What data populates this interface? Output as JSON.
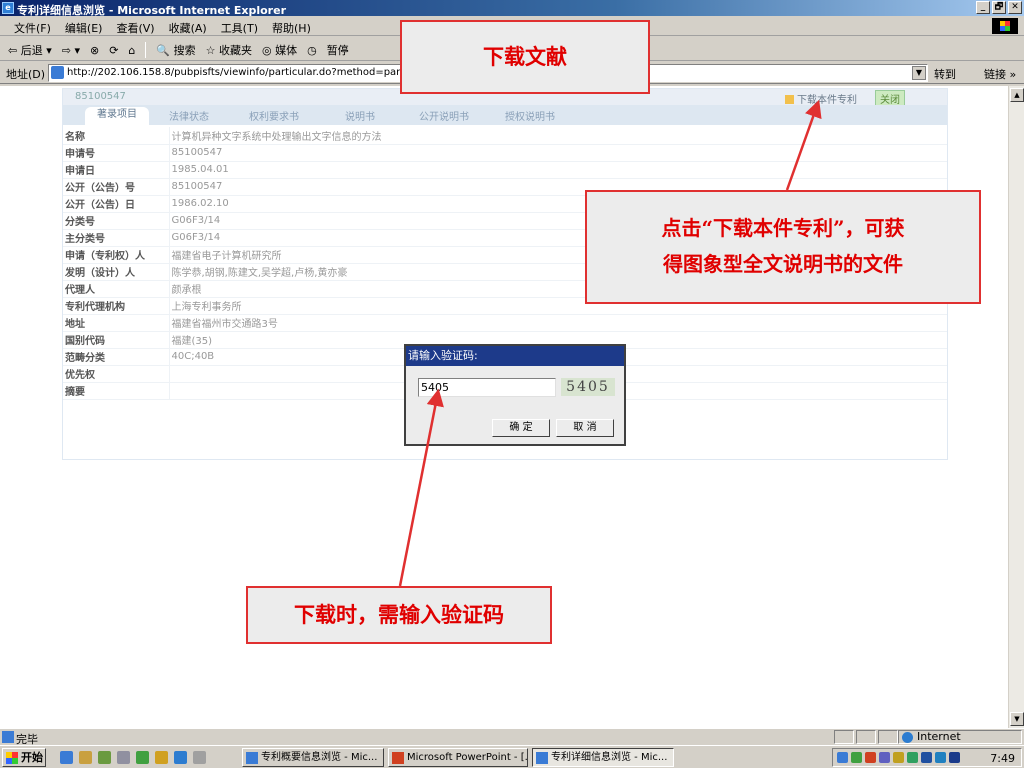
{
  "window": {
    "title": "专利详细信息浏览 - Microsoft Internet Explorer",
    "controls": [
      "_",
      "🗗",
      "✕"
    ]
  },
  "menu": [
    "文件(F)",
    "编辑(E)",
    "查看(V)",
    "收藏(A)",
    "工具(T)",
    "帮助(H)"
  ],
  "toolbar": [
    "⇦ 后退 ▾",
    "⇨ ▾",
    "⊗",
    "⟳",
    "⌂",
    "🔍 搜索",
    "☆ 收藏夹",
    "◎ 媒体",
    "◷",
    "暂停"
  ],
  "address": {
    "label": "地址(D)",
    "url": "http://202.106.158.8/pubpisfts/viewinfo/particular.do?method=partizlxm&ind",
    "go": "转到",
    "links": "链接 »"
  },
  "patent": {
    "number": "85100547",
    "download_link": "下载本件专利",
    "close": "关闭",
    "tabs": [
      "著录项目",
      "法律状态",
      "权利要求书",
      "说明书",
      "公开说明书",
      "授权说明书"
    ],
    "fields": [
      {
        "k": "名称",
        "v": "计算机异种文字系统中处理输出文字信息的方法"
      },
      {
        "k": "申请号",
        "v": "85100547"
      },
      {
        "k": "申请日",
        "v": "1985.04.01"
      },
      {
        "k": "公开（公告）号",
        "v": "85100547"
      },
      {
        "k": "公开（公告）日",
        "v": "1986.02.10"
      },
      {
        "k": "分类号",
        "v": "G06F3/14"
      },
      {
        "k": "主分类号",
        "v": "G06F3/14"
      },
      {
        "k": "申请（专利权）人",
        "v": "福建省电子计算机研究所"
      },
      {
        "k": "发明（设计）人",
        "v": "陈学恭,胡钢,陈建文,吴学超,卢杨,黄亦豪"
      },
      {
        "k": "代理人",
        "v": "颜承根"
      },
      {
        "k": "专利代理机构",
        "v": "上海专利事务所"
      },
      {
        "k": "地址",
        "v": "福建省福州市交通路3号"
      },
      {
        "k": "国别代码",
        "v": "福建(35)"
      },
      {
        "k": "范畴分类",
        "v": "40C;40B"
      },
      {
        "k": "优先权",
        "v": ""
      },
      {
        "k": "摘要",
        "v": ""
      }
    ]
  },
  "dialog": {
    "title": "请输入验证码:",
    "input_value": "5405",
    "captcha": "5405",
    "ok": "确 定",
    "cancel": "取 消"
  },
  "callouts": {
    "top": "下载文献",
    "right_line1": "点击“下载本件专利”，可获",
    "right_line2": "得图象型全文说明书的文件",
    "bottom": "下载时，需输入验证码"
  },
  "status": {
    "text": "完毕",
    "zone": "Internet"
  },
  "taskbar": {
    "start": "开始",
    "tasks": [
      "专利概要信息浏览 - Mic...",
      "Microsoft PowerPoint - [...",
      "专利详细信息浏览 - Mic..."
    ],
    "clock": "7:49"
  },
  "colors": {
    "callout_border": "#e03030",
    "callout_text": "#e00000",
    "dialog_title": "#1d3a8a"
  }
}
